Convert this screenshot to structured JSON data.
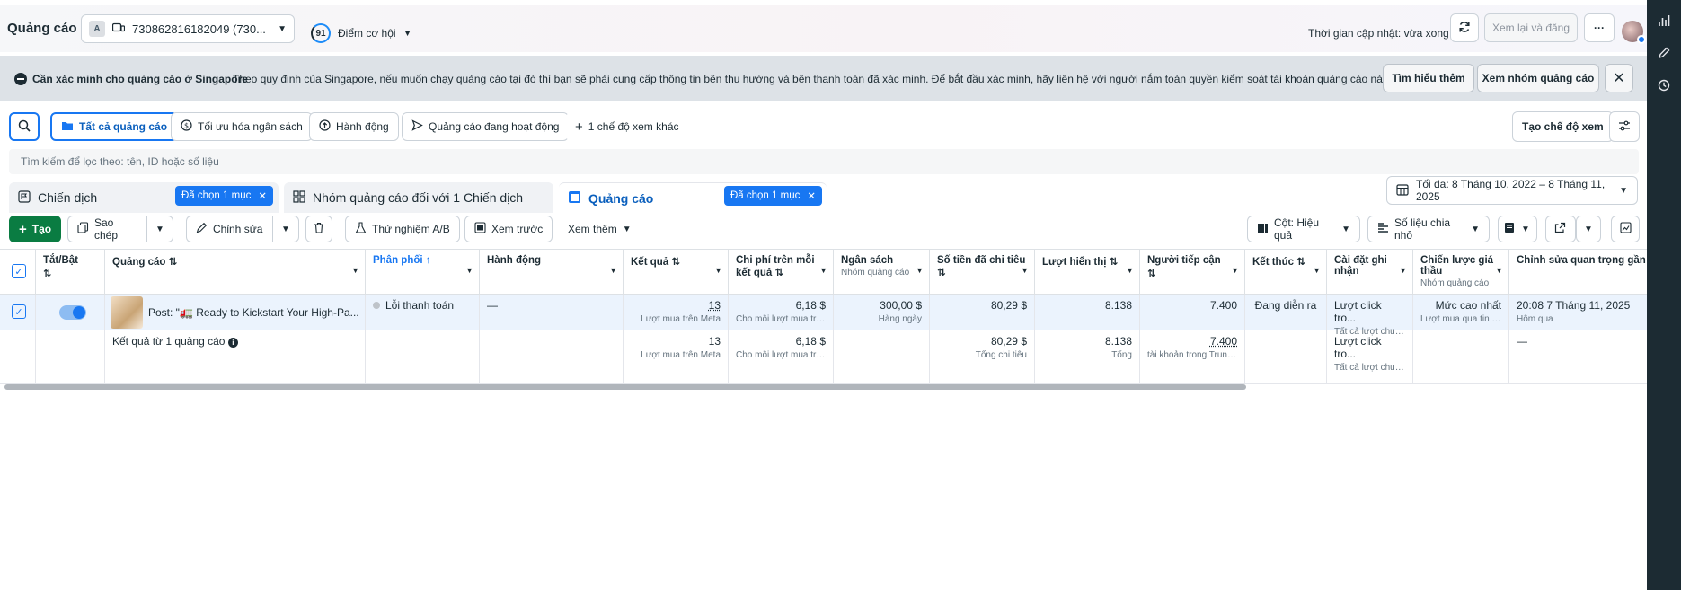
{
  "header": {
    "title": "Quảng cáo",
    "account_letter": "A",
    "account_text": "730862816182049 (730...",
    "score_value": "91",
    "score_label": "Điểm cơ hội",
    "update_time": "Thời gian cập nhật: vừa xong",
    "review_publish": "Xem lại và đăng",
    "more": "···"
  },
  "banner": {
    "title": "Cần xác minh cho quảng cáo ở Singapore",
    "text": "Theo quy định của Singapore, nếu muốn chạy quảng cáo tại đó thì bạn sẽ phải cung cấp thông tin bên thụ hưởng và bên thanh toán đã xác minh. Để bắt đầu xác minh, hãy liên hệ với người nắm toàn quyền kiểm soát tài khoản quảng cáo này.",
    "learn_more": "Tìm hiểu thêm",
    "view_adsets": "Xem nhóm quảng cáo"
  },
  "views": {
    "all_ads": "Tất cả quảng cáo",
    "budget_opt": "Tối ưu hóa ngân sách",
    "actions": "Hành động",
    "active_ads": "Quảng cáo đang hoạt động",
    "more_views": "1 chế độ xem khác",
    "create_view": "Tạo chế độ xem"
  },
  "search": {
    "placeholder": "Tìm kiếm để lọc theo: tên, ID hoặc số liệu"
  },
  "tabs": {
    "campaigns": "Chiến dịch",
    "campaigns_chip": "Đã chọn 1 mục",
    "adsets": "Nhóm quảng cáo đối với 1 Chiến dịch",
    "ads": "Quảng cáo",
    "ads_chip": "Đã chọn 1 mục"
  },
  "date_range": "Tối đa: 8 Tháng 10, 2022 – 8 Tháng 11, 2025",
  "toolbar": {
    "create": "Tạo",
    "duplicate": "Sao chép",
    "edit": "Chỉnh sửa",
    "ab_test": "Thử nghiệm A/B",
    "preview": "Xem trước",
    "see_more": "Xem thêm",
    "columns": "Cột: Hiệu quả",
    "breakdown": "Số liệu chia nhỏ"
  },
  "columns": {
    "on_off": "Tắt/Bật",
    "ad": "Quảng cáo",
    "delivery": "Phân phối",
    "actions": "Hành động",
    "results": "Kết quả",
    "cost_per_result": "Chi phí trên mỗi kết quả",
    "budget": "Ngân sách",
    "budget_sub": "Nhóm quảng cáo",
    "amount_spent": "Số tiền đã chi tiêu",
    "impressions": "Lượt hiển thị",
    "reach": "Người tiếp cận",
    "ends": "Kết thúc",
    "attribution": "Cài đặt ghi nhận",
    "bid_strategy": "Chiến lược giá thầu",
    "bid_strategy_sub": "Nhóm quảng cáo",
    "last_edit": "Chỉnh sửa quan trọng gần đây nhất"
  },
  "row": {
    "ad_name": "Post: \"🚛 Ready to Kickstart Your High-Pa...",
    "delivery": "Lỗi thanh toán",
    "actions": "—",
    "results": "13",
    "results_sub": "Lượt mua trên Meta",
    "cost": "6,18 $",
    "cost_sub": "Cho mỗi lượt mua trê...",
    "budget": "300,00 $",
    "budget_sub": "Hàng ngày",
    "spent": "80,29 $",
    "impressions": "8.138",
    "reach": "7.400",
    "ends": "Đang diễn ra",
    "attribution": "Lượt click tro...",
    "attribution_sub": "Tất cả lượt chuyể...",
    "bid": "Mức cao nhất",
    "bid_sub": "Lượt mua qua tin n...",
    "last_edit": "20:08 7 Tháng 11, 2025",
    "last_edit_sub": "Hôm qua"
  },
  "summary": {
    "label": "Kết quả từ 1 quảng cáo",
    "results": "13",
    "results_sub": "Lượt mua trên Meta",
    "cost": "6,18 $",
    "cost_sub": "Cho mỗi lượt mua trê...",
    "spent": "80,29 $",
    "spent_sub": "Tổng chi tiêu",
    "impressions": "8.138",
    "impressions_sub": "Tổng",
    "reach": "7.400",
    "reach_sub": "tài khoản trong Trung ...",
    "attribution": "Lượt click tro...",
    "attribution_sub": "Tất cả lượt chuyể...",
    "last_edit": "—"
  }
}
